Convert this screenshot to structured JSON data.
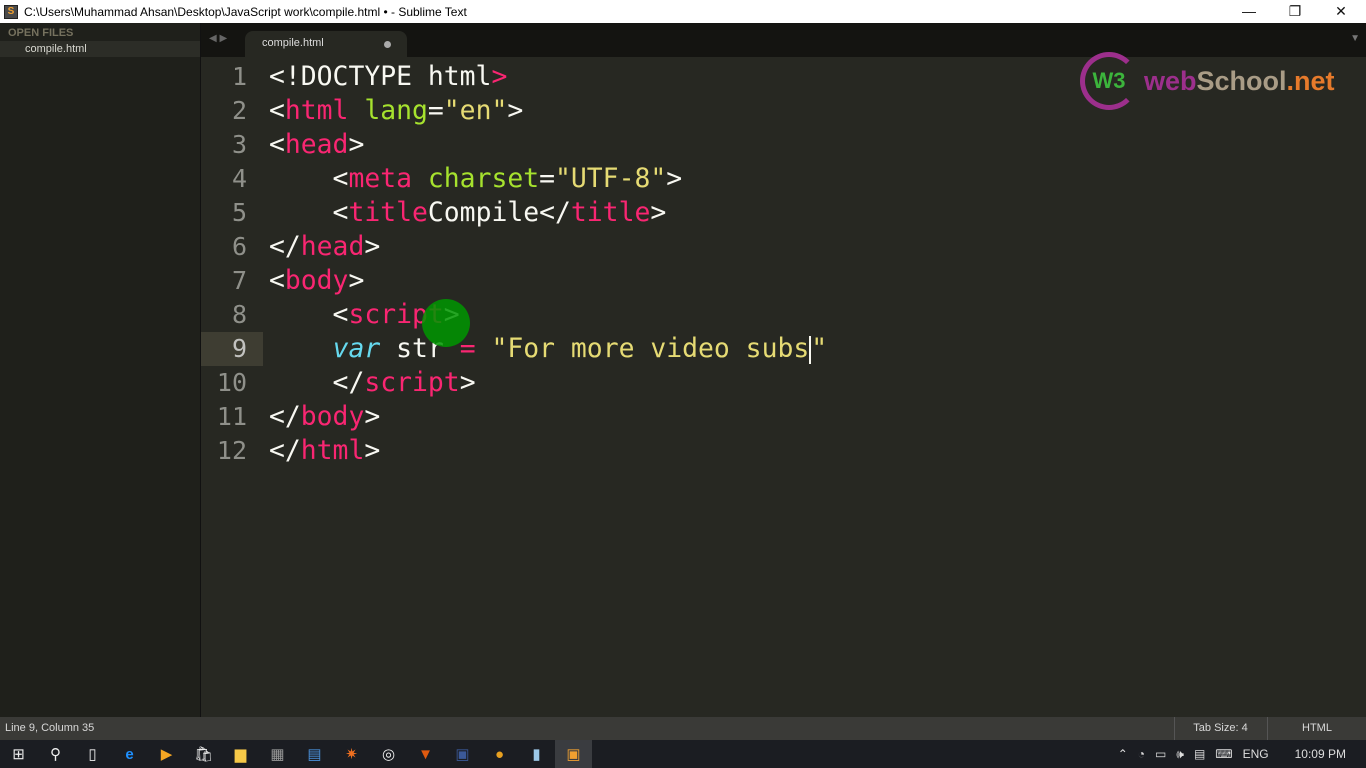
{
  "window": {
    "title": "C:\\Users\\Muhammad Ahsan\\Desktop\\JavaScript work\\compile.html • - Sublime Text",
    "minimize": "—",
    "maximize": "❐",
    "close": "✕"
  },
  "sidebar": {
    "header": "OPEN FILES",
    "files": [
      "compile.html"
    ]
  },
  "tabs": [
    {
      "label": "compile.html",
      "modified": true
    }
  ],
  "tabnav": {
    "back": "◀",
    "forward": "▶",
    "menu": "▼"
  },
  "editor": {
    "line_numbers": [
      "1",
      "2",
      "3",
      "4",
      "5",
      "6",
      "7",
      "8",
      "9",
      "10",
      "11",
      "12"
    ],
    "active_line": 9
  },
  "logo": {
    "mark": "W3",
    "web": "web",
    "school": "School",
    "net": ".net"
  },
  "status": {
    "position": "Line 9, Column 35",
    "tab_size": "Tab Size: 4",
    "syntax": "HTML"
  },
  "taskbar": {
    "icons": [
      "windows-start",
      "search",
      "task-view",
      "edge",
      "media-player",
      "store",
      "file-explorer",
      "calculator",
      "news",
      "sparkle-app",
      "camera-app",
      "fox-app",
      "facebook",
      "chrome",
      "notepad",
      "sublime-text"
    ]
  },
  "tray": {
    "language": "ENG",
    "time": "10:09 PM"
  }
}
